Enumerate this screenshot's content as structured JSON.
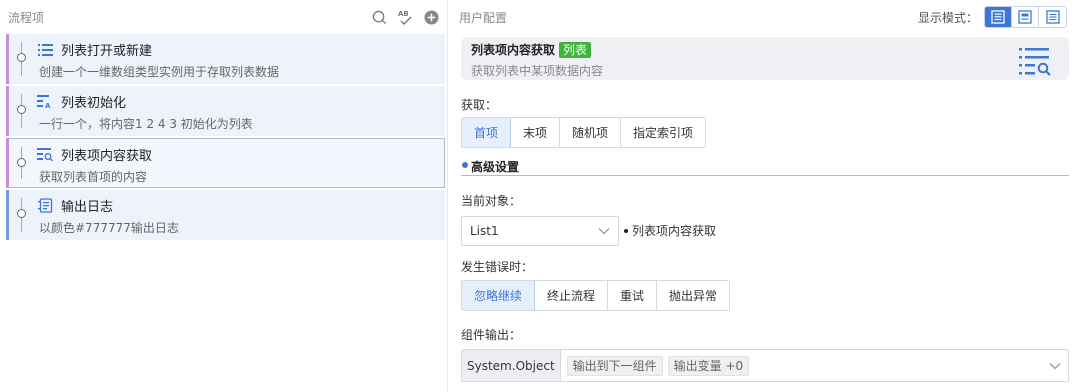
{
  "left": {
    "title": "流程项",
    "icons": [
      "search-icon",
      "spell-check-icon",
      "add-circle-icon"
    ]
  },
  "steps": [
    {
      "title": "列表打开或新建",
      "desc": "创建一个一维数组类型实例用于存取列表数据",
      "icon": "list-icon",
      "accent": "#c48fdf",
      "selected": false
    },
    {
      "title": "列表初始化",
      "desc": "一行一个，将内容1 2 4 3 初始化为列表",
      "icon": "list-init-icon",
      "accent": "#c48fdf",
      "selected": false
    },
    {
      "title": "列表项内容获取",
      "desc": "获取列表首项的内容",
      "icon": "list-search-icon",
      "accent": "#c48fdf",
      "selected": true
    },
    {
      "title": "输出日志",
      "desc": "以颜色#777777输出日志",
      "icon": "log-icon",
      "accent": "#6f9fdc",
      "selected": false
    }
  ],
  "right": {
    "title": "用户配置",
    "display_mode_label": "显示模式：",
    "modes": [
      "mode-full-icon",
      "mode-compact-icon",
      "mode-list-icon"
    ],
    "active_mode": 0
  },
  "card": {
    "title": "列表项内容获取",
    "tag": "列表",
    "desc": "获取列表中某项数据内容",
    "icon": "list-search-icon"
  },
  "fetch": {
    "label": "获取：",
    "options": [
      "首项",
      "末项",
      "随机项",
      "指定索引项"
    ],
    "active": 0
  },
  "advanced": {
    "title": "高级设置"
  },
  "target": {
    "label": "当前对象：",
    "value": "List1",
    "note": "列表项内容获取"
  },
  "error": {
    "label": "发生错误时：",
    "options": [
      "忽略继续",
      "终止流程",
      "重试",
      "抛出异常"
    ],
    "active": 0
  },
  "output": {
    "label": "组件输出：",
    "type": "System.Object",
    "chips": [
      "输出到下一组件",
      "输出变量 +0"
    ]
  },
  "colors": {
    "accent_blue": "#3d76d6",
    "tag_green": "#3fb33f",
    "step_purple": "#c48fdf",
    "step_blue": "#6f9fdc"
  }
}
